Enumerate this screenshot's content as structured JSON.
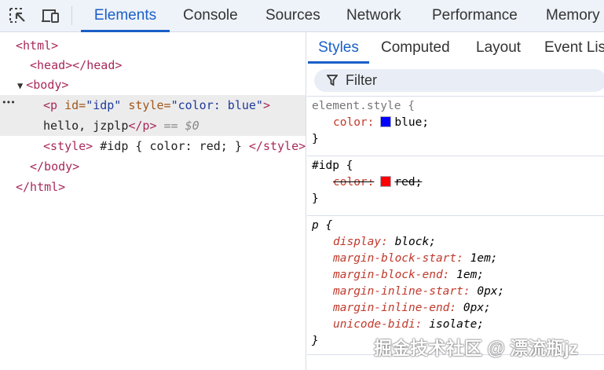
{
  "toolbar": {
    "tabs": [
      "Elements",
      "Console",
      "Sources",
      "Network",
      "Performance",
      "Memory"
    ],
    "active": "Elements"
  },
  "dom": {
    "html_open": "<html>",
    "head": "<head></head>",
    "body_open": "<body>",
    "ellipsis": "•••",
    "p_tag_open": "<p",
    "p_id_attr": " id=",
    "p_id_val": "\"idp\"",
    "p_style_attr": " style=",
    "p_style_val": "\"color: blue\"",
    "p_tag_close": ">",
    "p_text": "hello, jzplp",
    "p_end": "</p>",
    "selected_marker": "== $0",
    "style_open": "<style>",
    "style_text": " #idp { color: red; } ",
    "style_close": "</style>",
    "body_close": "</body>",
    "html_close": "</html>"
  },
  "styles_pane": {
    "tabs": [
      "Styles",
      "Computed",
      "Layout",
      "Event Lis"
    ],
    "filter_placeholder": "Filter",
    "rules": [
      {
        "selector": "element.style {",
        "props": [
          {
            "name": "color:",
            "value": "blue;",
            "swatch": "#0000ff"
          }
        ]
      },
      {
        "selector": "#idp {",
        "props": [
          {
            "name": "color:",
            "value": "red;",
            "swatch": "#ff0000",
            "overridden": true
          }
        ]
      },
      {
        "selector": "p {",
        "props": [
          {
            "name": "display:",
            "value": " block;"
          },
          {
            "name": "margin-block-start:",
            "value": " 1em;"
          },
          {
            "name": "margin-block-end:",
            "value": " 1em;"
          },
          {
            "name": "margin-inline-start:",
            "value": " 0px;"
          },
          {
            "name": "margin-inline-end:",
            "value": " 0px;"
          },
          {
            "name": "unicode-bidi:",
            "value": " isolate;"
          }
        ]
      }
    ],
    "close_brace": "}"
  },
  "watermark": "掘金技术社区 @ 漂流瓶jz"
}
